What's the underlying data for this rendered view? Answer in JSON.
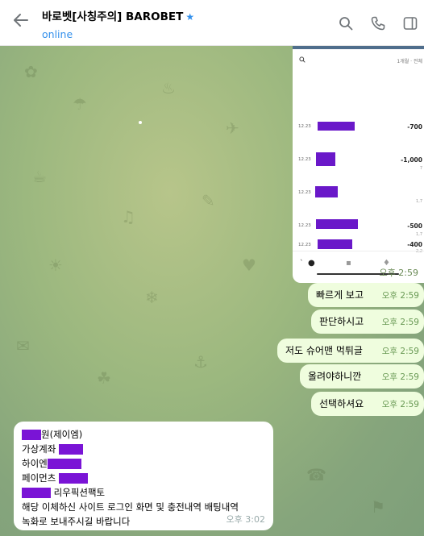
{
  "header": {
    "title": "바로벳[사칭주의] BAROBET",
    "status": "online",
    "icons": [
      "back-arrow-icon",
      "search-icon",
      "phone-icon",
      "sidebar-toggle-icon"
    ]
  },
  "colors": {
    "accent": "#3390ec",
    "outgoing_bubble": "#effdde",
    "incoming_bubble": "#ffffff",
    "redaction": "#7a14d6"
  },
  "image_message": {
    "month_label": "1개월 · 전체",
    "rows": [
      {
        "date": "12.23",
        "amount": "-700",
        "sub": ""
      },
      {
        "date": "12.23",
        "amount": "-1,000",
        "sub": "7"
      },
      {
        "date": "12.23",
        "amount": "",
        "sub": "1,7"
      },
      {
        "date": "12.23",
        "amount": "-500",
        "sub": "1,7"
      },
      {
        "date": "12.23",
        "amount": "-400",
        "sub": "2,2"
      }
    ],
    "caption": "`",
    "time": "오후 2:59"
  },
  "outgoing": [
    {
      "text": "빠르게 보고",
      "time": "오후 2:59"
    },
    {
      "text": "판단하시고",
      "time": "오후 2:59"
    },
    {
      "text": "저도 슈어맨 먹튀글",
      "time": "오후 2:59"
    },
    {
      "text": "올려야하니깐",
      "time": "오후 2:59"
    },
    {
      "text": "선택하셔요",
      "time": "오후 2:59"
    }
  ],
  "incoming": {
    "lines": [
      "원(제이엠)",
      "가상계좌",
      "하이엔",
      "페이먼츠",
      "리우픽션팩토",
      "해당 이체하신 사이트 로그인 화면 및 충전내역 배팅내역",
      "녹화로 보내주시길 바랍니다"
    ],
    "time": "오후 3:02"
  }
}
